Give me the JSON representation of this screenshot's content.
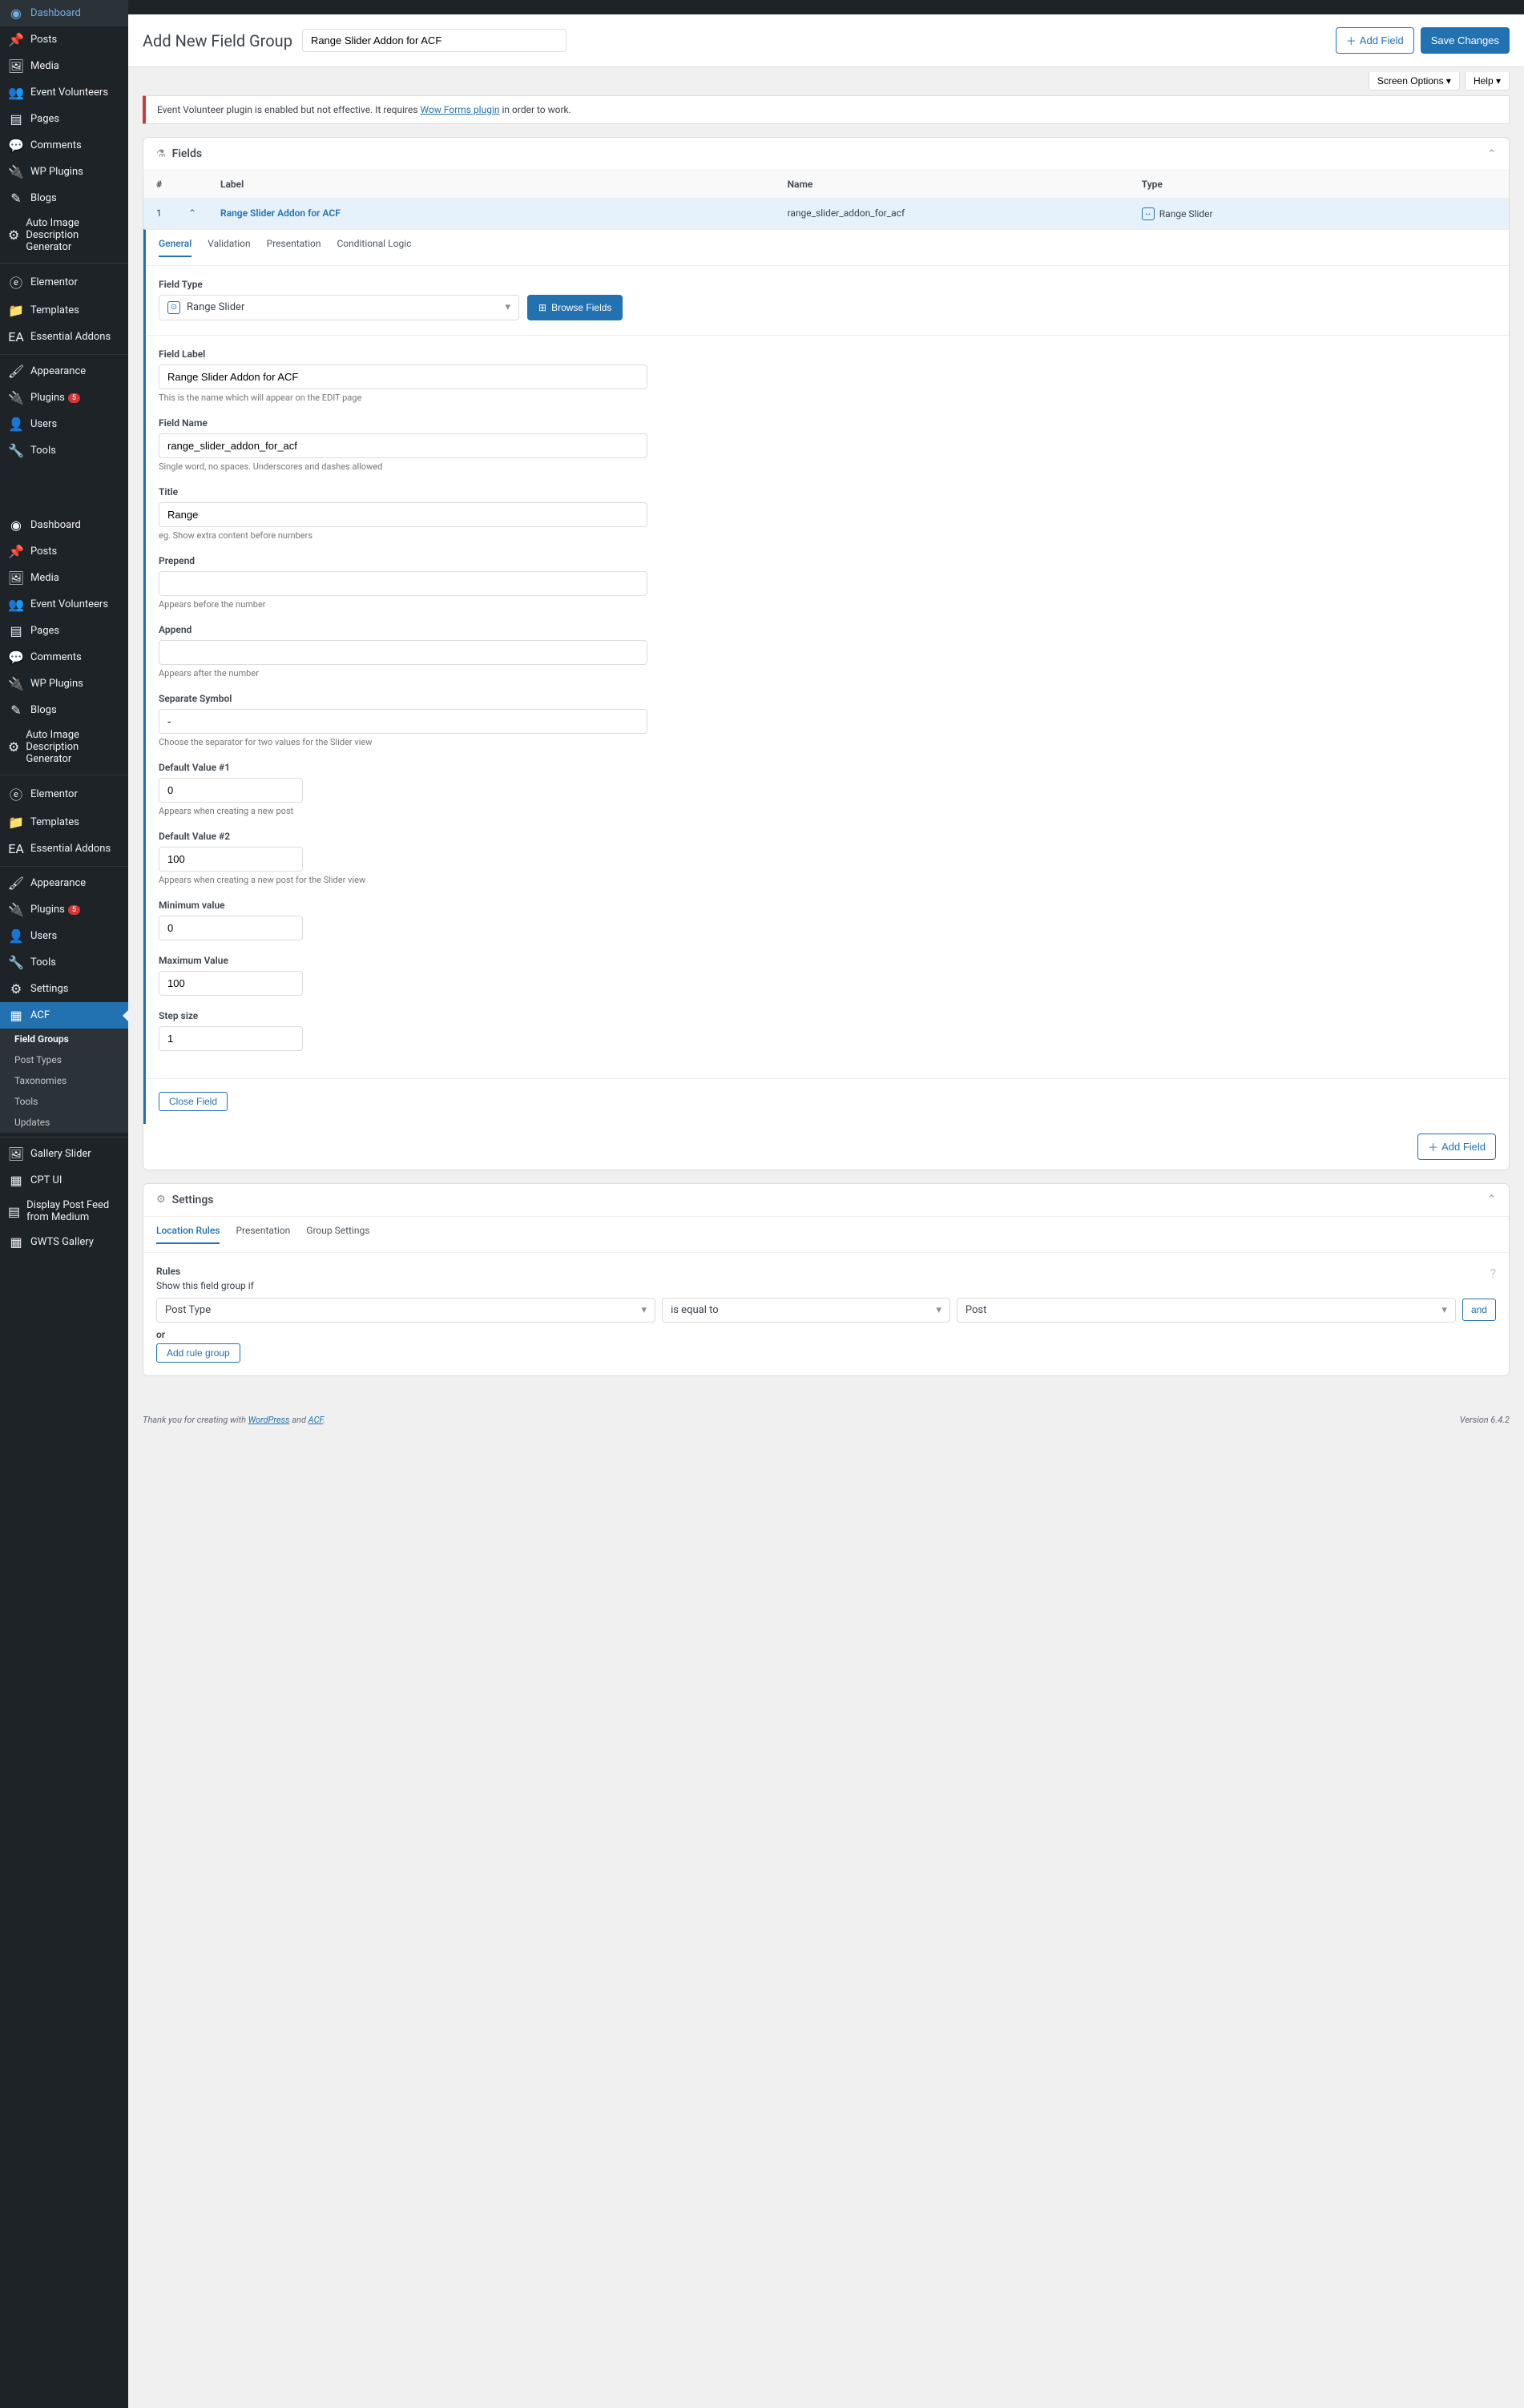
{
  "sidebar": {
    "top": [
      {
        "icon": "◉",
        "label": "Dashboard",
        "name": "dashboard"
      },
      {
        "icon": "📌",
        "label": "Posts",
        "name": "posts"
      },
      {
        "icon": "🖼",
        "label": "Media",
        "name": "media"
      },
      {
        "icon": "👥",
        "label": "Event Volunteers",
        "name": "event-volunteers"
      },
      {
        "icon": "▤",
        "label": "Pages",
        "name": "pages"
      },
      {
        "icon": "💬",
        "label": "Comments",
        "name": "comments"
      },
      {
        "icon": "🔌",
        "label": "WP Plugins",
        "name": "wp-plugins"
      },
      {
        "icon": "✎",
        "label": "Blogs",
        "name": "blogs"
      },
      {
        "icon": "⚙",
        "label": "Auto Image Description Generator",
        "name": "auto-image-desc"
      }
    ],
    "mid1": [
      {
        "icon": "ⓔ",
        "label": "Elementor",
        "name": "elementor"
      },
      {
        "icon": "📁",
        "label": "Templates",
        "name": "templates"
      },
      {
        "icon": "EA",
        "label": "Essential Addons",
        "name": "essential-addons"
      }
    ],
    "mid2": [
      {
        "icon": "🖌",
        "label": "Appearance",
        "name": "appearance"
      },
      {
        "icon": "🔌",
        "label": "Plugins",
        "name": "plugins",
        "badge": "5"
      },
      {
        "icon": "👤",
        "label": "Users",
        "name": "users"
      },
      {
        "icon": "🔧",
        "label": "Tools",
        "name": "tools"
      }
    ],
    "bottom": [
      {
        "icon": "◉",
        "label": "Dashboard",
        "name": "dashboard2"
      },
      {
        "icon": "📌",
        "label": "Posts",
        "name": "posts2"
      },
      {
        "icon": "🖼",
        "label": "Media",
        "name": "media2"
      },
      {
        "icon": "👥",
        "label": "Event Volunteers",
        "name": "event-volunteers2"
      },
      {
        "icon": "▤",
        "label": "Pages",
        "name": "pages2"
      },
      {
        "icon": "💬",
        "label": "Comments",
        "name": "comments2"
      },
      {
        "icon": "🔌",
        "label": "WP Plugins",
        "name": "wp-plugins2"
      },
      {
        "icon": "✎",
        "label": "Blogs",
        "name": "blogs2"
      },
      {
        "icon": "⚙",
        "label": "Auto Image Description Generator",
        "name": "auto-image-desc2"
      }
    ],
    "bmid1": [
      {
        "icon": "ⓔ",
        "label": "Elementor",
        "name": "elementor2"
      },
      {
        "icon": "📁",
        "label": "Templates",
        "name": "templates2"
      },
      {
        "icon": "EA",
        "label": "Essential Addons",
        "name": "essential-addons2"
      }
    ],
    "bmid2": [
      {
        "icon": "🖌",
        "label": "Appearance",
        "name": "appearance2"
      },
      {
        "icon": "🔌",
        "label": "Plugins",
        "name": "plugins2",
        "badge": "5"
      },
      {
        "icon": "👤",
        "label": "Users",
        "name": "users2"
      },
      {
        "icon": "🔧",
        "label": "Tools",
        "name": "tools2"
      },
      {
        "icon": "⚙",
        "label": "Settings",
        "name": "settings"
      }
    ],
    "acf": {
      "icon": "▦",
      "label": "ACF",
      "subs": [
        "Field Groups",
        "Post Types",
        "Taxonomies",
        "Tools",
        "Updates"
      ]
    },
    "tail": [
      {
        "icon": "🖼",
        "label": "Gallery Slider",
        "name": "gallery-slider"
      },
      {
        "icon": "▦",
        "label": "CPT UI",
        "name": "cpt-ui"
      },
      {
        "icon": "▤",
        "label": "Display Post Feed from Medium",
        "name": "display-post-feed"
      },
      {
        "icon": "▦",
        "label": "GWTS Gallery",
        "name": "gwts-gallery"
      }
    ]
  },
  "header": {
    "title": "Add New Field Group",
    "group_title": "Range Slider Addon for ACF",
    "add_field": "Add Field",
    "save": "Save Changes"
  },
  "screen_opts": {
    "screen": "Screen Options",
    "help": "Help"
  },
  "notice": {
    "pre": "Event Volunteer plugin is enabled but not effective. It requires ",
    "link": "Wow Forms plugin",
    "post": " in order to work."
  },
  "fields_panel": {
    "title": "Fields",
    "cols": {
      "num": "#",
      "label": "Label",
      "name": "Name",
      "type": "Type"
    }
  },
  "field_row": {
    "num": "1",
    "label": "Range Slider Addon for ACF",
    "name": "range_slider_addon_for_acf",
    "type": "Range Slider"
  },
  "editor_tabs": [
    "General",
    "Validation",
    "Presentation",
    "Conditional Logic"
  ],
  "form": {
    "field_type": {
      "label": "Field Type",
      "value": "Range Slider",
      "browse": "Browse Fields"
    },
    "field_label": {
      "label": "Field Label",
      "value": "Range Slider Addon for ACF",
      "help": "This is the name which will appear on the EDIT page"
    },
    "field_name": {
      "label": "Field Name",
      "value": "range_slider_addon_for_acf",
      "help": "Single word, no spaces. Underscores and dashes allowed"
    },
    "title": {
      "label": "Title",
      "value": "Range",
      "help": "eg. Show extra content before numbers"
    },
    "prepend": {
      "label": "Prepend",
      "value": "",
      "help": "Appears before the number"
    },
    "append": {
      "label": "Append",
      "value": "",
      "help": "Appears after the number"
    },
    "separate": {
      "label": "Separate Symbol",
      "value": "-",
      "help": "Choose the separator for two values for the Slider view"
    },
    "default1": {
      "label": "Default Value #1",
      "value": "0",
      "help": "Appears when creating a new post"
    },
    "default2": {
      "label": "Default Value #2",
      "value": "100",
      "help": "Appears when creating a new post for the Slider view"
    },
    "min": {
      "label": "Minimum value",
      "value": "0"
    },
    "max": {
      "label": "Maximum Value",
      "value": "100"
    },
    "step": {
      "label": "Step size",
      "value": "1"
    },
    "close": "Close Field"
  },
  "add_field_btn": "Add Field",
  "settings_panel": {
    "title": "Settings",
    "tabs": [
      "Location Rules",
      "Presentation",
      "Group Settings"
    ]
  },
  "rules": {
    "label": "Rules",
    "desc": "Show this field group if",
    "param": "Post Type",
    "op": "is equal to",
    "val": "Post",
    "and": "and",
    "or": "or",
    "add": "Add rule group"
  },
  "footer": {
    "pre": "Thank you for creating with ",
    "wp": "WordPress",
    "and": " and ",
    "acf": "ACF",
    "period": ".",
    "version": "Version 6.4.2"
  }
}
